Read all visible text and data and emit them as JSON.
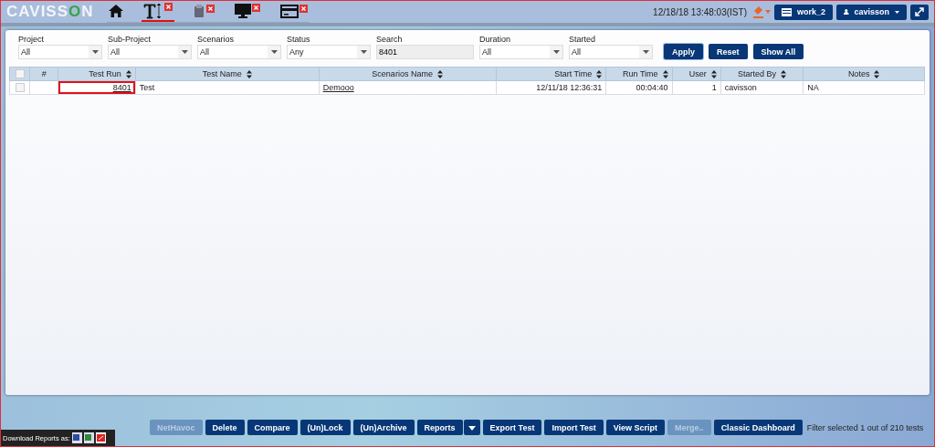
{
  "logo": [
    "CAVISS",
    "O",
    "N"
  ],
  "tabs": [
    {
      "kind": "home",
      "selected": false,
      "closable": false
    },
    {
      "kind": "text",
      "selected": true,
      "closable": true
    },
    {
      "kind": "clipboard",
      "selected": false,
      "closable": true
    },
    {
      "kind": "monitor",
      "selected": false,
      "closable": true
    },
    {
      "kind": "card",
      "selected": false,
      "closable": true
    }
  ],
  "datetime": "12/18/18 13:48:03(IST)",
  "workspace": "work_2",
  "user": "cavisson",
  "filters": [
    {
      "label": "Project",
      "kind": "select",
      "value": "All"
    },
    {
      "label": "Sub-Project",
      "kind": "select",
      "value": "All"
    },
    {
      "label": "Scenarios",
      "kind": "select",
      "value": "All"
    },
    {
      "label": "Status",
      "kind": "select",
      "value": "Any"
    },
    {
      "label": "Search",
      "kind": "input",
      "value": "8401"
    },
    {
      "label": "Duration",
      "kind": "select",
      "value": "All"
    },
    {
      "label": "Started",
      "kind": "select",
      "value": "All"
    }
  ],
  "filter_buttons": [
    "Apply",
    "Reset",
    "Show All"
  ],
  "table": {
    "select_all_checked": false,
    "columns": [
      {
        "label": "#",
        "sortable": false
      },
      {
        "label": "Test Run",
        "sortable": true
      },
      {
        "label": "Test Name",
        "sortable": true
      },
      {
        "label": "Scenarios Name",
        "sortable": true
      },
      {
        "label": "Start Time",
        "sortable": true
      },
      {
        "label": "Run Time",
        "sortable": true
      },
      {
        "label": "User",
        "sortable": true
      },
      {
        "label": "Started By",
        "sortable": true
      },
      {
        "label": "Notes",
        "sortable": true
      }
    ],
    "rows": [
      {
        "checked": false,
        "cells": [
          "",
          "8401",
          "Test",
          "Demooo",
          "12/11/18 12:36:31",
          "00:04:40",
          "1",
          "cavisson",
          "NA"
        ]
      }
    ]
  },
  "actions": [
    {
      "label": "NetHavoc",
      "disabled": true,
      "dropdown": false
    },
    {
      "label": "Delete",
      "disabled": false,
      "dropdown": false
    },
    {
      "label": "Compare",
      "disabled": false,
      "dropdown": false
    },
    {
      "label": "(Un)Lock",
      "disabled": false,
      "dropdown": false
    },
    {
      "label": "(Un)Archive",
      "disabled": false,
      "dropdown": false
    },
    {
      "label": "Reports",
      "disabled": false,
      "dropdown": true
    },
    {
      "label": "Export Test",
      "disabled": false,
      "dropdown": false
    },
    {
      "label": "Import Test",
      "disabled": false,
      "dropdown": false
    },
    {
      "label": "View Script",
      "disabled": false,
      "dropdown": false
    },
    {
      "label": "Merge..",
      "disabled": true,
      "dropdown": false
    },
    {
      "label": "Classic Dashboard",
      "disabled": false,
      "dropdown": false
    }
  ],
  "filter_status": "Filter selected 1 out of 210 tests",
  "download_label": "Download Reports as:"
}
